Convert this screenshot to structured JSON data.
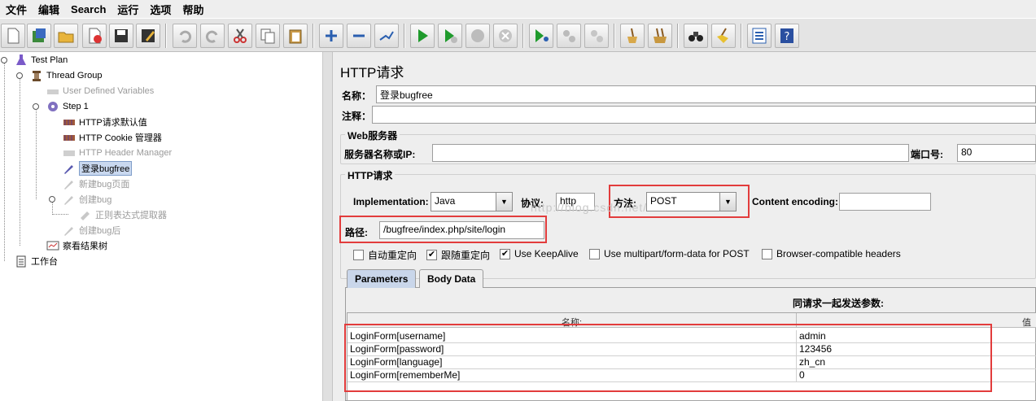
{
  "menu": [
    "文件",
    "编辑",
    "Search",
    "运行",
    "选项",
    "帮助"
  ],
  "toolbar": [
    "new-icon",
    "templates-icon",
    "open-icon",
    "close-icon",
    "save-icon",
    "save-as-icon",
    "undo-icon",
    "redo-icon",
    "cut-icon",
    "copy-icon",
    "paste-icon",
    "expand-icon",
    "collapse-icon",
    "toggle-icon",
    "start-icon",
    "start-no-timers-icon",
    "stop-icon",
    "shutdown-icon",
    "remote-start-icon",
    "remote-stop-icon",
    "remote-exit-icon",
    "clear-icon",
    "clear-all-icon",
    "search-icon",
    "reset-search-icon",
    "function-helper-icon",
    "help-icon"
  ],
  "tree": {
    "test_plan": "Test Plan",
    "thread_group": "Thread Group",
    "user_vars": "User Defined Variables",
    "step1": "Step 1",
    "http_defaults": "HTTP请求默认值",
    "cookie_mgr": "HTTP Cookie 管理器",
    "header_mgr": "HTTP Header Manager",
    "login": "登录bugfree",
    "new_bug_page": "新建bug页面",
    "create_bug": "创建bug",
    "regex": "正则表达式提取器",
    "after_create": "创建bug后",
    "results_tree": "察看结果树",
    "workbench": "工作台"
  },
  "panel": {
    "title": "HTTP请求",
    "name_label": "名称：",
    "name_value": "登录bugfree",
    "comment_label": "注释：",
    "web_server_title": "Web服务器",
    "server_label": "服务器名称或IP:",
    "server_value": "",
    "port_label": "端口号:",
    "port_value": "80",
    "http_req_title": "HTTP请求",
    "impl_label": "Implementation:",
    "impl_value": "Java",
    "protocol_label": "协议:",
    "protocol_value": "http",
    "method_label": "方法:",
    "method_value": "POST",
    "encoding_label": "Content encoding:",
    "encoding_value": "",
    "path_label": "路径:",
    "path_value": "/bugfree/index.php/site/login",
    "watermark": "http://blog.csdn.net/",
    "checkboxes": [
      {
        "label": "自动重定向",
        "checked": false
      },
      {
        "label": "跟随重定向",
        "checked": true
      },
      {
        "label": "Use KeepAlive",
        "checked": true
      },
      {
        "label": "Use multipart/form-data for POST",
        "checked": false
      },
      {
        "label": "Browser-compatible headers",
        "checked": false
      }
    ],
    "tabs": [
      "Parameters",
      "Body Data"
    ],
    "params_caption": "同请求一起发送参数:",
    "col_name": "名称:",
    "col_value": "值",
    "params": [
      {
        "name": "LoginForm[username]",
        "value": "admin"
      },
      {
        "name": "LoginForm[password]",
        "value": "123456"
      },
      {
        "name": "LoginForm[language]",
        "value": "zh_cn"
      },
      {
        "name": "LoginForm[rememberMe]",
        "value": "0"
      }
    ]
  }
}
